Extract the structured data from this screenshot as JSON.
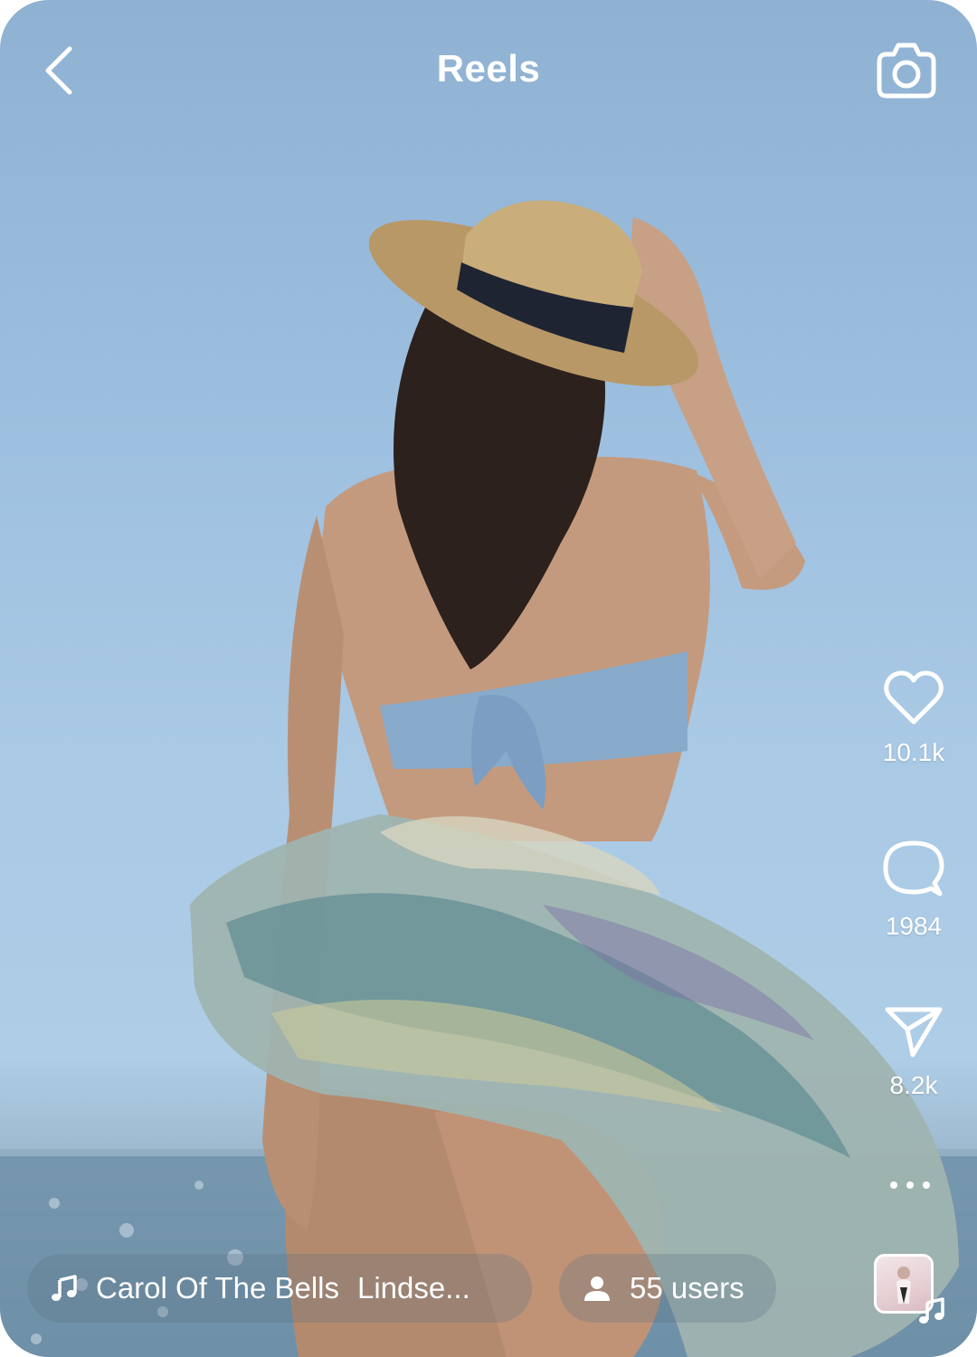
{
  "header": {
    "title": "Reels"
  },
  "actions": {
    "likes": "10.1k",
    "comments": "1984",
    "shares": "8.2k"
  },
  "bottom": {
    "song_title": "Carol Of The Bells",
    "song_artist": "Lindse...",
    "users": "55 users"
  },
  "icons": {
    "back": "chevron-left-icon",
    "camera": "camera-icon",
    "like": "heart-icon",
    "comment": "comment-bubble-icon",
    "share": "paper-plane-icon",
    "more": "more-dots-icon",
    "music": "music-note-icon",
    "user": "user-icon"
  },
  "colors": {
    "text": "#ffffff",
    "sky": "#a9c9e5",
    "pill_bg": "rgba(90,110,130,0.28)"
  }
}
